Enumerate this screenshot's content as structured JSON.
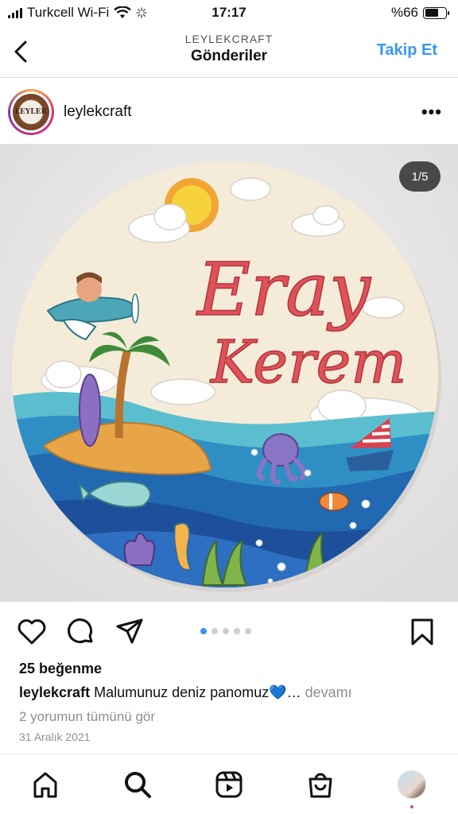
{
  "status_bar": {
    "carrier": "Turkcell Wi-Fi",
    "time": "17:17",
    "battery": "%66",
    "battery_level": 0.66
  },
  "header": {
    "account_label": "LEYLEKCRAFT",
    "title": "Gönderiler",
    "follow_label": "Takip Et",
    "back_icon": "chevron-left-icon"
  },
  "post": {
    "username": "leylekcraft",
    "avatar_text": "LEYLEK",
    "more_icon": "more-horizontal-icon",
    "image": {
      "counter": "1/5",
      "sign_line1": "Eray",
      "sign_line2": "Kerem"
    },
    "carousel": {
      "total": 5,
      "active": 1
    },
    "likes": "25 beğenme",
    "caption_user": "leylekcraft",
    "caption_text": "Malumunuz deniz panomuz💙…",
    "caption_more": "devamı",
    "comments_link": "2 yorumun tümünü gör",
    "date": "31 Aralık 2021",
    "colors": {
      "accent": "#3897f0",
      "script_text": "#e0525a",
      "sea": "#2f8fc4"
    }
  },
  "tabbar": {
    "items": [
      "home-icon",
      "search-icon",
      "reels-icon",
      "shop-icon",
      "profile-avatar"
    ]
  }
}
